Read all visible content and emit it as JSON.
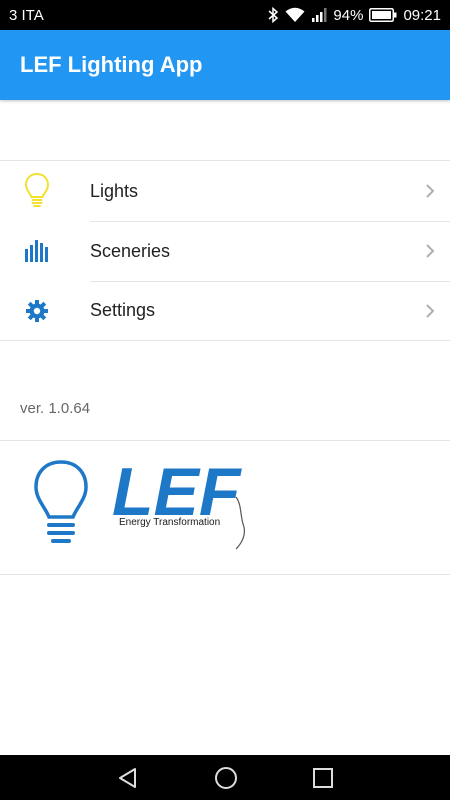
{
  "status_bar": {
    "carrier": "3 ITA",
    "battery_pct": "94%",
    "time": "09:21"
  },
  "app_bar": {
    "title": "LEF Lighting App",
    "color": "#2196F3"
  },
  "menu": {
    "items": [
      {
        "label": "Lights",
        "icon": "lightbulb-icon"
      },
      {
        "label": "Sceneries",
        "icon": "equalizer-bars-icon"
      },
      {
        "label": "Settings",
        "icon": "gear-icon"
      }
    ]
  },
  "version": "ver. 1.0.64",
  "logo": {
    "wordmark": "LEF",
    "tagline": "Energy Transformation"
  },
  "nav_bar": {
    "buttons": [
      "back-icon",
      "home-icon",
      "recents-icon"
    ]
  }
}
